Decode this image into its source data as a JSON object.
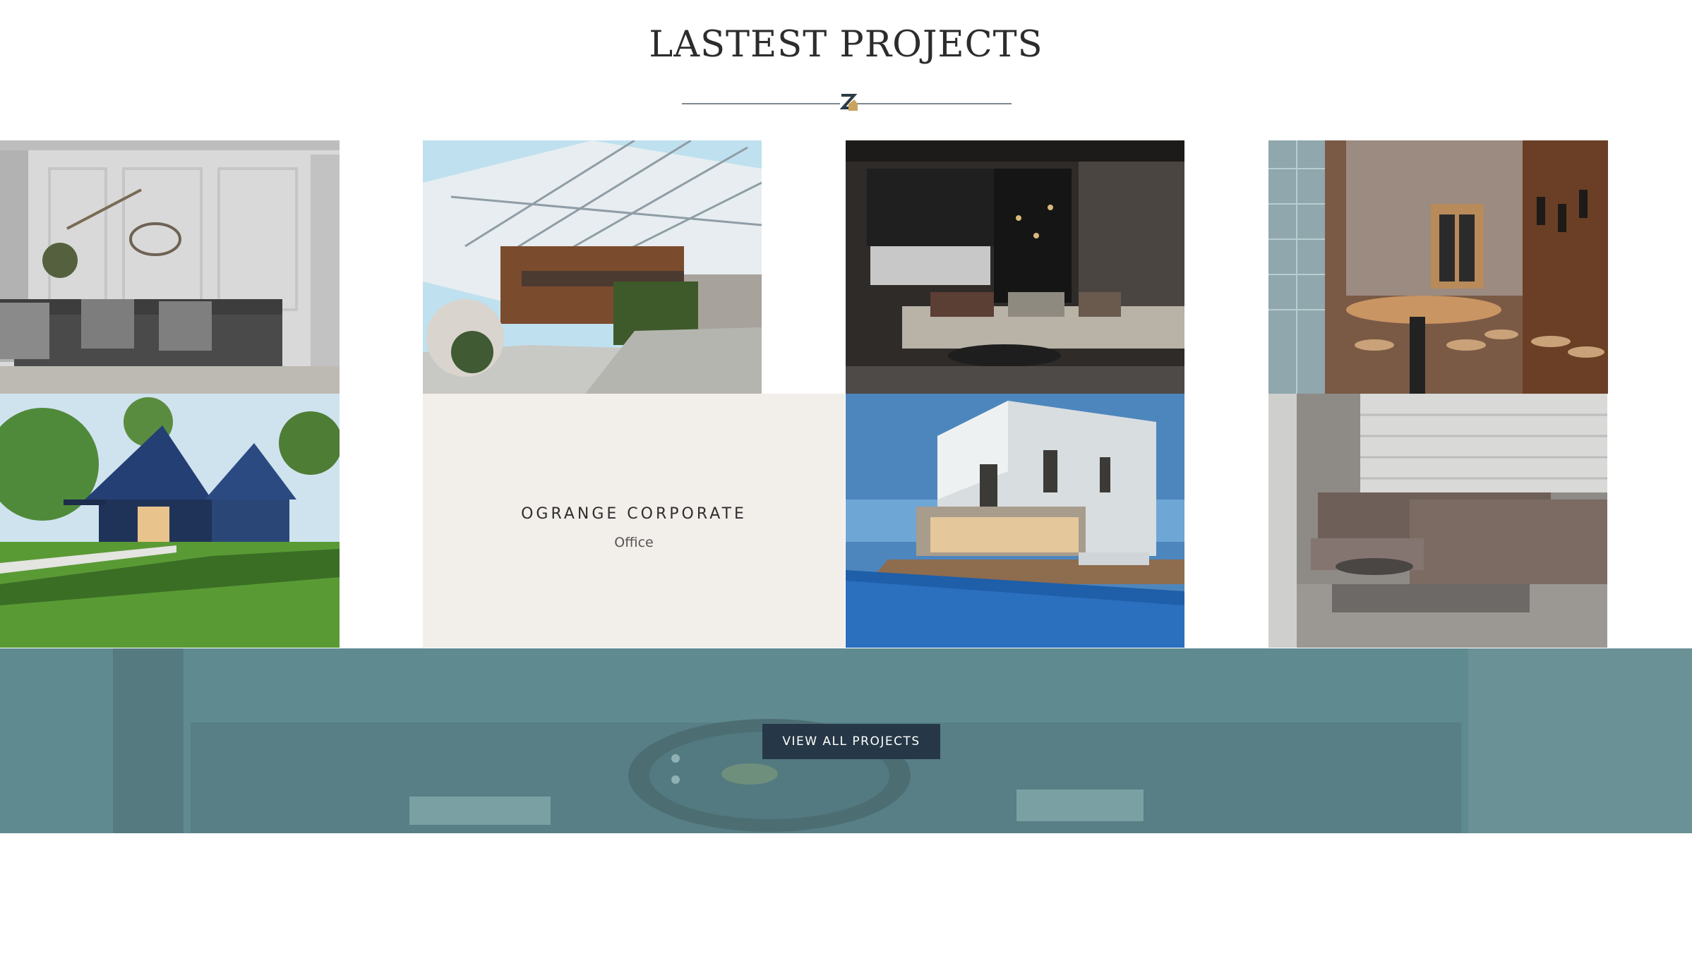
{
  "section": {
    "title": "LASTEST PROJECTS"
  },
  "featured_project": {
    "name": "OGRANGE CORPORATE",
    "category": "Office"
  },
  "cta": {
    "label": "VIEW ALL PROJECTS"
  },
  "colors": {
    "accent": "#263847",
    "banner_overlay": "#5f8a90",
    "info_bg": "#f2eeea",
    "logo_accent": "#c8a45c"
  },
  "icons": {
    "logo": "z-logo-icon"
  }
}
